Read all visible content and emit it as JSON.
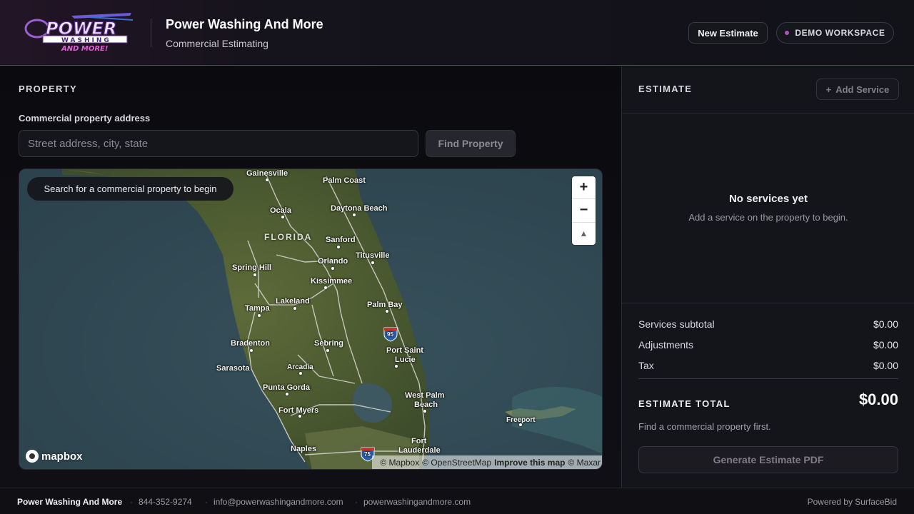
{
  "header": {
    "logo": {
      "line1": "POWER",
      "line2": "WASHING",
      "line3": "AND MORE!"
    },
    "title": "Power Washing And More",
    "subtitle": "Commercial Estimating",
    "new_estimate_label": "New Estimate",
    "workspace_label": "DEMO WORKSPACE"
  },
  "property": {
    "section_label": "PROPERTY",
    "field_label": "Commercial property address",
    "address_placeholder": "Street address, city, state",
    "address_value": "",
    "find_button_label": "Find Property"
  },
  "map": {
    "hint": "Search for a commercial property to begin",
    "zoom_in": "+",
    "zoom_out": "−",
    "compass": "▲",
    "logo_text": "mapbox",
    "attribution": {
      "mapbox": "© Mapbox",
      "osm": "© OpenStreetMap",
      "improve": "Improve this map",
      "maxar": "© Maxar"
    },
    "state_label": "FLORIDA",
    "cities": {
      "gainesville": "Gainesville",
      "palm_coast": "Palm Coast",
      "ocala": "Ocala",
      "daytona": "Daytona Beach",
      "sanford": "Sanford",
      "titusville": "Titusville",
      "spring_hill": "Spring Hill",
      "orlando": "Orlando",
      "kissimmee": "Kissimmee",
      "tampa": "Tampa",
      "lakeland": "Lakeland",
      "palm_bay": "Palm Bay",
      "bradenton": "Bradenton",
      "sebring": "Sebring",
      "port_st_lucie_1": "Port Saint",
      "port_st_lucie_2": "Lucie",
      "sarasota": "Sarasota",
      "arcadia": "Arcadia",
      "punta_gorda": "Punta Gorda",
      "west_palm_1": "West Palm",
      "west_palm_2": "Beach",
      "fort_myers": "Fort Myers",
      "freeport": "Freeport",
      "naples": "Naples",
      "fort_laud_1": "Fort",
      "fort_laud_2": "Lauderdale"
    },
    "shields": {
      "i95": "95",
      "i75": "75"
    }
  },
  "estimate": {
    "section_label": "ESTIMATE",
    "add_service_label": "Add Service",
    "empty_title": "No services yet",
    "empty_sub": "Add a service on the property to begin.",
    "subtotal_label": "Services subtotal",
    "subtotal_value": "$0.00",
    "adjustments_label": "Adjustments",
    "adjustments_value": "$0.00",
    "tax_label": "Tax",
    "tax_value": "$0.00",
    "total_label": "ESTIMATE TOTAL",
    "total_value": "$0.00",
    "note": "Find a commercial property first.",
    "pdf_button_label": "Generate Estimate PDF"
  },
  "footer": {
    "company": "Power Washing And More",
    "phone": "844-352-9274",
    "email": "info@powerwashingandmore.com",
    "website": "powerwashingandmore.com",
    "powered_by": "Powered by SurfaceBid"
  },
  "colors": {
    "accent": "#b04fc0",
    "background": "#0d0d12",
    "panel": "#14141b"
  }
}
